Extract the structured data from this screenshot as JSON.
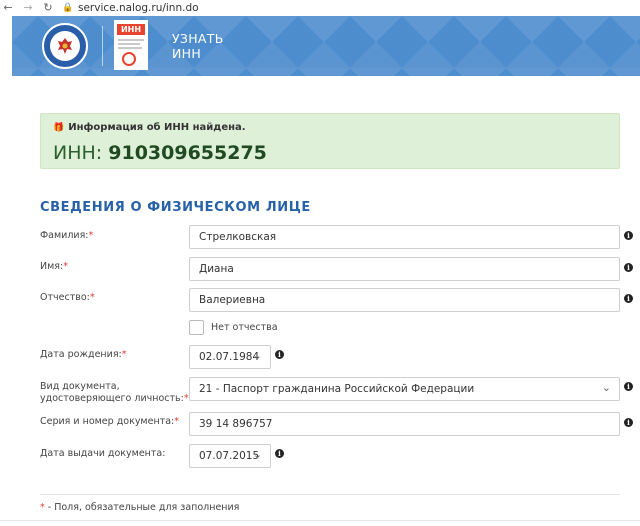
{
  "browser": {
    "url": "service.nalog.ru/inn.do"
  },
  "header": {
    "badge_text": "ИНН",
    "title_line1": "УЗНАТЬ",
    "title_line2": "ИНН"
  },
  "alert": {
    "message": "Информация об ИНН найдена.",
    "inn_prefix": "ИНН:",
    "inn_value": "910309655275"
  },
  "section": {
    "title": "СВЕДЕНИЯ О ФИЗИЧЕСКОМ ЛИЦЕ"
  },
  "form": {
    "lastname": {
      "label": "Фамилия:",
      "value": "Стрелковская"
    },
    "firstname": {
      "label": "Имя:",
      "value": "Диана"
    },
    "patronymic": {
      "label": "Отчество:",
      "value": "Валериевна"
    },
    "no_patronymic": {
      "label": "Нет отчества",
      "checked": false
    },
    "birthdate": {
      "label": "Дата рождения:",
      "value": "02.07.1984"
    },
    "doc_type": {
      "label_line1": "Вид документа,",
      "label_line2": "удостоверяющего личность:",
      "value": "21 - Паспорт гражданина Российской Федерации"
    },
    "doc_number": {
      "label": "Серия и номер документа:",
      "value": "39 14 896757"
    },
    "issue_date": {
      "label": "Дата выдачи документа:",
      "value": "07.07.2015"
    },
    "required_mark": "*",
    "required_note": "- Поля, обязательные для заполнения"
  },
  "colors": {
    "header_bg": "#4d8ccd",
    "alert_bg": "#dff0d8",
    "section_title": "#2761a8",
    "required": "#e03c31"
  }
}
